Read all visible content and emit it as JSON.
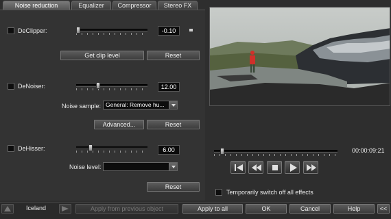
{
  "tabs": [
    {
      "label": "Noise reduction"
    },
    {
      "label": "Equalizer"
    },
    {
      "label": "Compressor"
    },
    {
      "label": "Stereo FX"
    }
  ],
  "declipper": {
    "label": "DeClipper:",
    "value": "-0.10",
    "level": 0.0,
    "get_clip_level": "Get clip level",
    "reset": "Reset"
  },
  "denoiser": {
    "label": "DeNoiser:",
    "value": "12.00",
    "level": 0.3,
    "noise_sample_label": "Noise sample:",
    "noise_sample_value": "General: Remove  hu...",
    "advanced": "Advanced...",
    "reset": "Reset"
  },
  "dehisser": {
    "label": "DeHisser:",
    "value": "6.00",
    "level": 0.18,
    "noise_level_label": "Noise level:",
    "noise_level_value": "",
    "reset": "Reset"
  },
  "transport": {
    "timecode": "00:00:09:21",
    "position": 0.05,
    "buttons": [
      "skip-start-icon",
      "rewind-icon",
      "stop-icon",
      "play-icon",
      "fast-forward-icon"
    ]
  },
  "bypass_label": "Temporarily switch off all effects",
  "footer": {
    "object_name": "Iceland",
    "apply_prev": "Apply from previous object",
    "apply_all": "Apply to all",
    "ok": "OK",
    "cancel": "Cancel",
    "help": "Help",
    "collapse": "<<"
  },
  "colors": {
    "accent_red": "#d0302a",
    "panel_bg": "#333333"
  }
}
